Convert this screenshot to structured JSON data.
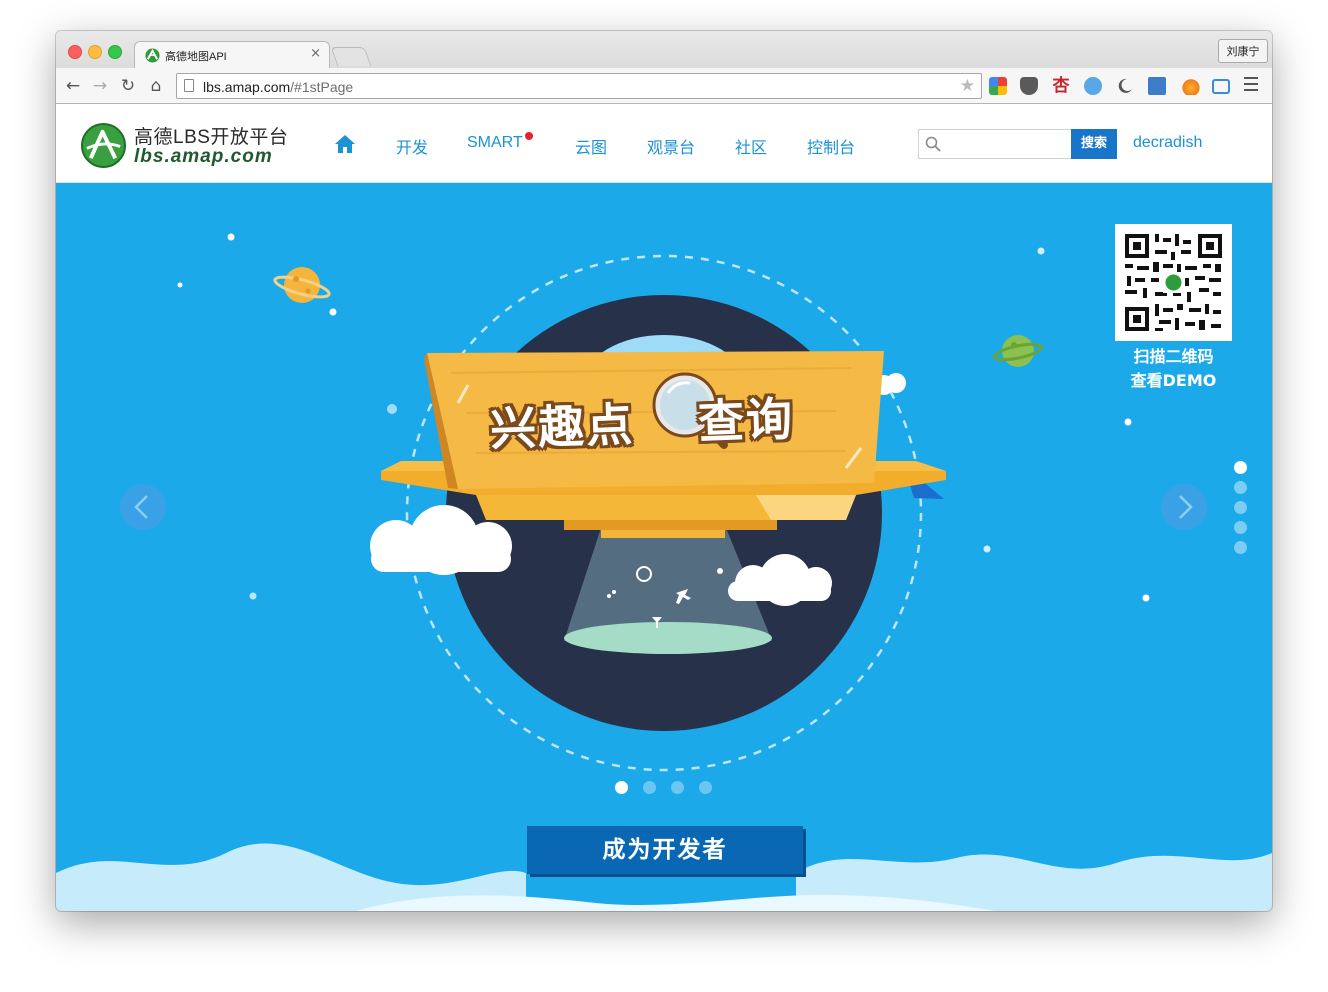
{
  "browser": {
    "tab_title": "高德地图API",
    "tab_close": "×",
    "profile_name": "刘康宁",
    "url_host": "lbs.amap.com",
    "url_path": "/#1stPage",
    "star": "★",
    "back": "←",
    "forward": "→",
    "reload": "↻",
    "home": "⌂"
  },
  "site": {
    "logo_title": "高德LBS开放平台",
    "logo_domain": "lbs.amap.com",
    "nav": [
      "开发",
      "SMART",
      "云图",
      "观景台",
      "社区",
      "控制台"
    ],
    "search_placeholder": "",
    "search_button": "搜索",
    "username": "decradish"
  },
  "hero": {
    "banner_left": "兴趣点",
    "banner_right": "查询",
    "qr_caption_line1": "扫描二维码",
    "qr_caption_line2": "查看DEMO",
    "cta_label": "成为开发者",
    "active_slide": 1,
    "slide_count": 4,
    "side_page_count": 5,
    "active_side_page": 1
  },
  "colors": {
    "hero_bg": "#1ba9ea",
    "nav_link": "#1a92d6",
    "search_button": "#1875c9",
    "cta": "#0a67b4",
    "smart_badge": "#e3232e",
    "ufo_yellow": "#f6b93b",
    "planet_dark": "#27324a"
  },
  "icons": {
    "home": "home-icon",
    "search": "search-icon",
    "prev": "chevron-left-icon",
    "next": "chevron-right-icon"
  }
}
